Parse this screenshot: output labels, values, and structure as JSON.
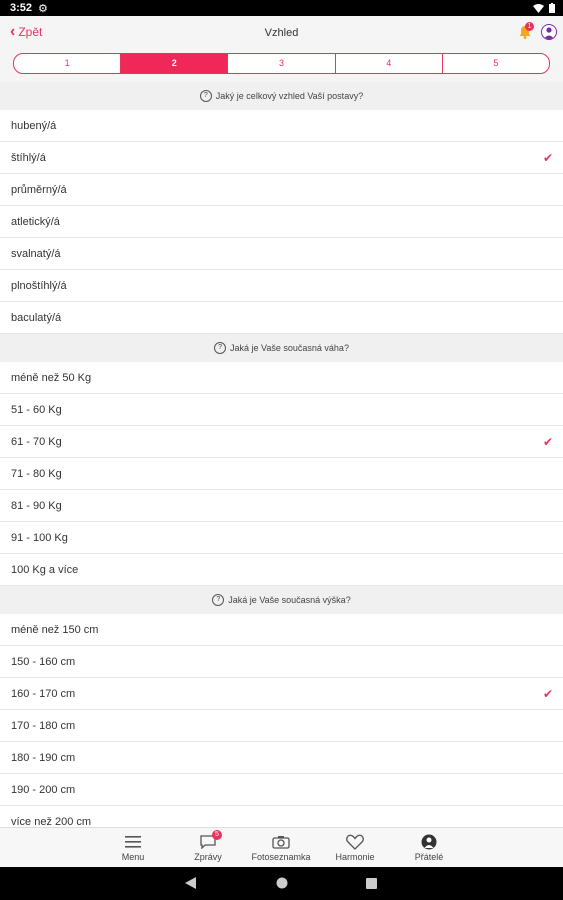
{
  "status": {
    "time": "3:52"
  },
  "header": {
    "back_label": "Zpět",
    "title": "Vzhled",
    "notification_count": "1"
  },
  "steps": [
    "1",
    "2",
    "3",
    "4",
    "5"
  ],
  "active_step": "2",
  "sections": [
    {
      "question": "Jaký je celkový vzhled Vaší postavy?",
      "options": [
        {
          "label": "hubený/á",
          "selected": false
        },
        {
          "label": "štíhlý/á",
          "selected": true
        },
        {
          "label": "průměrný/á",
          "selected": false
        },
        {
          "label": "atletický/á",
          "selected": false
        },
        {
          "label": "svalnatý/á",
          "selected": false
        },
        {
          "label": "plnoštíhlý/á",
          "selected": false
        },
        {
          "label": "baculatý/á",
          "selected": false
        }
      ]
    },
    {
      "question": "Jaká je Vaše současná váha?",
      "options": [
        {
          "label": "méně než 50 Kg",
          "selected": false
        },
        {
          "label": "51 - 60 Kg",
          "selected": false
        },
        {
          "label": "61 - 70 Kg",
          "selected": true
        },
        {
          "label": "71 - 80 Kg",
          "selected": false
        },
        {
          "label": "81 - 90 Kg",
          "selected": false
        },
        {
          "label": "91 - 100 Kg",
          "selected": false
        },
        {
          "label": "100 Kg a více",
          "selected": false
        }
      ]
    },
    {
      "question": "Jaká je Vaše současná výška?",
      "options": [
        {
          "label": "méně než 150 cm",
          "selected": false
        },
        {
          "label": "150 - 160 cm",
          "selected": false
        },
        {
          "label": "160 - 170 cm",
          "selected": true
        },
        {
          "label": "170 - 180 cm",
          "selected": false
        },
        {
          "label": "180 - 190 cm",
          "selected": false
        },
        {
          "label": "190 - 200 cm",
          "selected": false
        },
        {
          "label": "více než 200 cm",
          "selected": false
        }
      ]
    }
  ],
  "tabbar": [
    {
      "label": "Menu",
      "icon": "menu-icon"
    },
    {
      "label": "Zprávy",
      "icon": "chat-icon",
      "badge": "5"
    },
    {
      "label": "Fotoseznamka",
      "icon": "camera-icon"
    },
    {
      "label": "Harmonie",
      "icon": "heart-icon"
    },
    {
      "label": "Přátelé",
      "icon": "friends-icon"
    }
  ]
}
